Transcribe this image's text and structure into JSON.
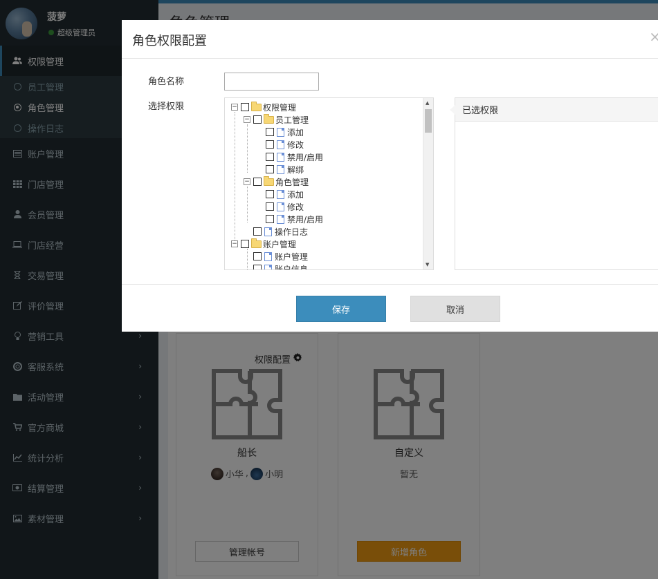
{
  "sidebar": {
    "user_name": "菠萝",
    "user_role": "超级管理员",
    "active_menu": "权限管理",
    "submenu": [
      "员工管理",
      "角色管理",
      "操作日志"
    ],
    "menu": [
      "账户管理",
      "门店管理",
      "会员管理",
      "门店经营",
      "交易管理",
      "评价管理",
      "营销工具",
      "客服系统",
      "活动管理",
      "官方商城",
      "统计分析",
      "结算管理",
      "素材管理"
    ]
  },
  "main": {
    "title": "角色管理",
    "cards": [
      {
        "config_label": "权限配置",
        "name": "船长",
        "members": [
          "小华",
          "小明"
        ],
        "button": "管理帐号"
      },
      {
        "name": "自定义",
        "members_text": "暂无",
        "button": "新增角色"
      }
    ]
  },
  "modal": {
    "title": "角色权限配置",
    "close": "×",
    "role_name_label": "角色名称",
    "role_name_value": "",
    "perm_label": "选择权限",
    "selected_title": "已选权限",
    "tree": {
      "root1": "权限管理",
      "staff": "员工管理",
      "staff_children": [
        "添加",
        "修改",
        "禁用/启用",
        "解绑"
      ],
      "role": "角色管理",
      "role_children": [
        "添加",
        "修改",
        "禁用/启用"
      ],
      "log": "操作日志",
      "root2": "账户管理",
      "acc_children": [
        "账户管理",
        "账户信息"
      ]
    },
    "save": "保存",
    "cancel": "取消"
  }
}
